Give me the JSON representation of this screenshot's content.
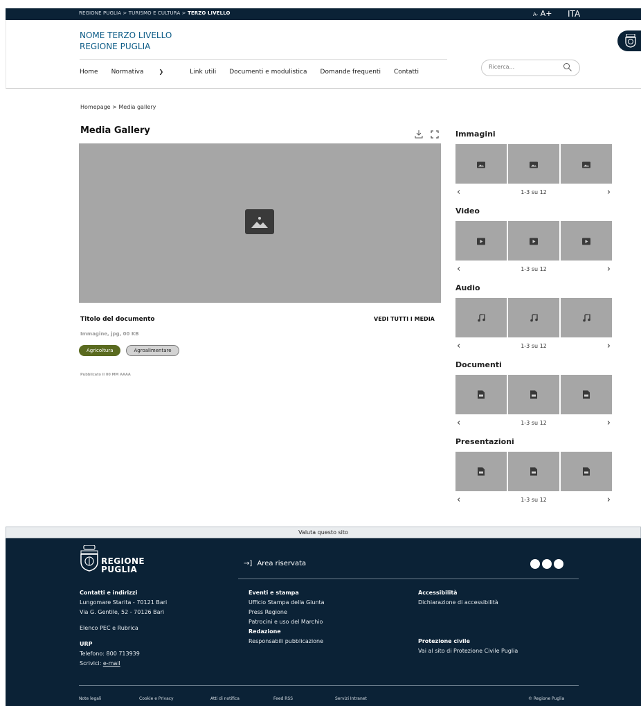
{
  "topbar": {
    "crumb_1": "REGIONE PUGLIA",
    "crumb_sep_1": " > ",
    "crumb_2": "TURISMO E CULTURA",
    "crumb_sep_2": " > ",
    "crumb_3": "TERZO LIVELLO",
    "font_small": "A-",
    "font_large": "A+",
    "language": "ITA"
  },
  "header": {
    "site_name_line1": "NOME TERZO LIVELLO",
    "site_name_line2": "REGIONE PUGLIA",
    "nav": [
      "Home",
      "Normativa",
      "Link utili",
      "Documenti e modulistica",
      "Domande frequenti",
      "Contatti"
    ],
    "search_placeholder": "Ricerca..."
  },
  "breadcrumb": {
    "home": "Homepage",
    "sep": " > ",
    "current": "Media gallery"
  },
  "main": {
    "title": "Media Gallery",
    "doc_title": "Titolo del documento",
    "see_all": "VEDI TUTTI I MEDIA",
    "meta": "Immagine, jpg, 00 KB",
    "tags": [
      "Agricoltura",
      "Agroalimentare"
    ],
    "published": "Pubblicato il 00 MM AAAA"
  },
  "sections": [
    {
      "title": "Immagini",
      "icon": "image-icon",
      "pager": "1-3 su 12"
    },
    {
      "title": "Video",
      "icon": "play-icon",
      "pager": "1-3 su 12"
    },
    {
      "title": "Audio",
      "icon": "music-note-icon",
      "pager": "1-3 su 12"
    },
    {
      "title": "Documenti",
      "icon": "document-icon",
      "pager": "1-3 su 12"
    },
    {
      "title": "Presentazioni",
      "icon": "presentation-icon",
      "pager": "1-3 su 12"
    }
  ],
  "footer": {
    "rate": "Valuta questo sito",
    "logo_line1": "REGIONE",
    "logo_line2": "PUGLIA",
    "reserved_area": "Area riservata",
    "contacts_title": "Contatti e indirizzi",
    "contacts_line1": "Lungomare Starita - 70121 Bari",
    "contacts_line2": "Via G. Gentile, 52 - 70126 Bari",
    "pec": "Elenco PEC e Rubrica",
    "urp_title": "URP",
    "urp_phone": "Telefono: 800 713939",
    "urp_write": "Scrivici: ",
    "urp_email": "e-mail",
    "events_title": "Eventi e stampa",
    "events_1": "Ufficio Stampa della Giunta",
    "events_2": "Press Regione",
    "events_3": "Patrocini e uso del Marchio",
    "editorial_title": "Redazione",
    "editorial_1": "Responsabili pubblicazione",
    "access_title": "Accessibilità",
    "access_1": "Dichiarazione di accessibilità",
    "civil_title": "Protezione civile",
    "civil_1": "Vai al sito di Protezione Civile Puglia",
    "links": [
      "Note legali",
      "Cookie e Privacy",
      "Atti di notifica",
      "Feed RSS",
      "Servizi Intranet"
    ],
    "copyright": "© Regione Puglia"
  },
  "colors": {
    "navy": "#0b2236",
    "link_blue": "#0d5c87",
    "tag_green": "#5a6a1f",
    "placeholder_gray": "#a6a6a6"
  }
}
